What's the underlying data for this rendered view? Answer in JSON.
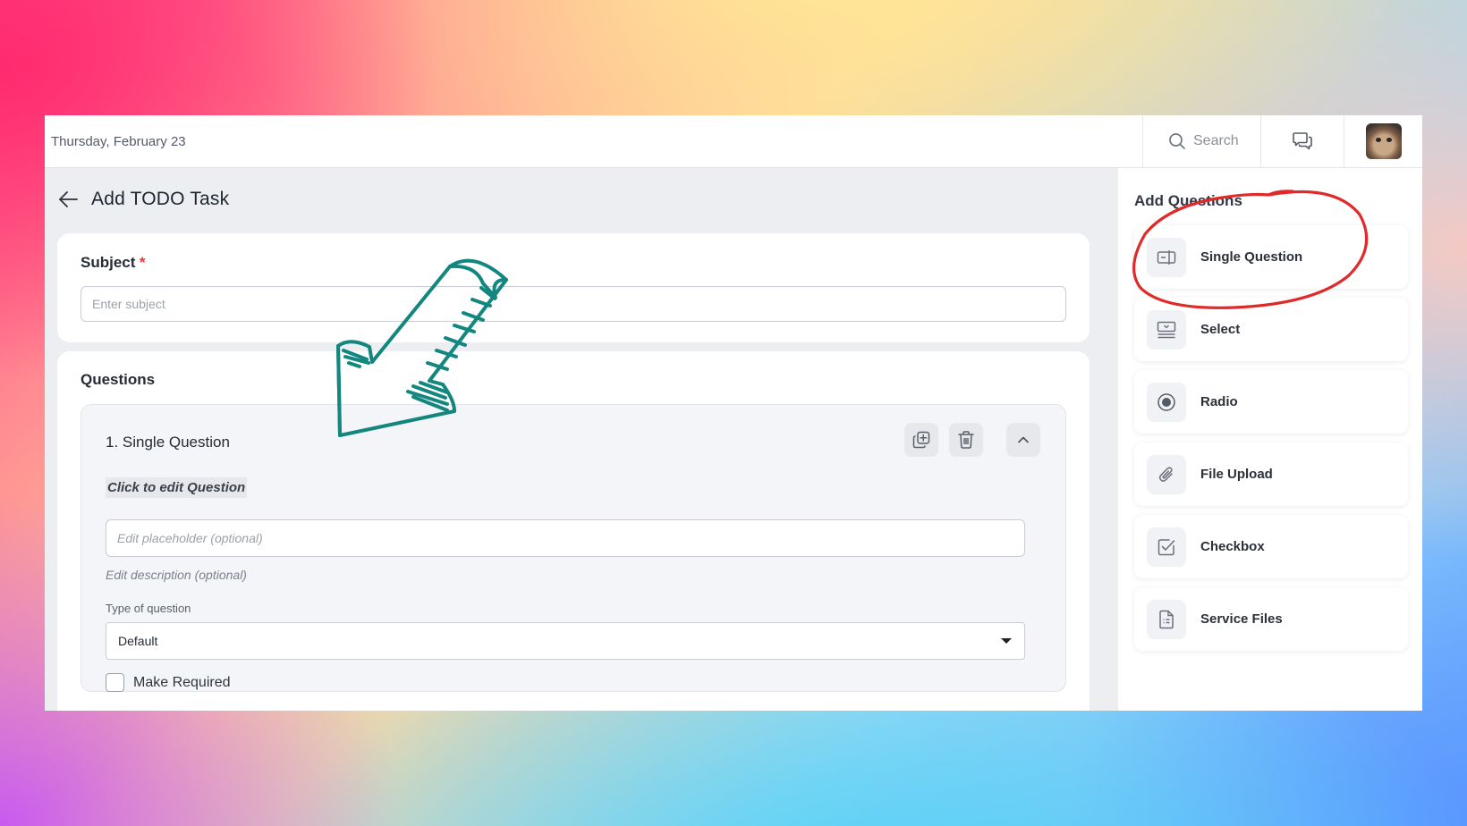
{
  "topbar": {
    "date": "Thursday, February 23",
    "search_label": "Search"
  },
  "page": {
    "title": "Add TODO Task"
  },
  "subject": {
    "label": "Subject",
    "required_mark": "*",
    "placeholder": "Enter subject"
  },
  "questions": {
    "label": "Questions",
    "items": [
      {
        "title": "1. Single Question",
        "edit_question": "Click to edit Question",
        "placeholder_hint": "Edit placeholder (optional)",
        "description_hint": "Edit description (optional)",
        "type_label": "Type of question",
        "type_value": "Default",
        "required_label": "Make Required",
        "required_checked": false
      }
    ]
  },
  "side_panel": {
    "title": "Add Questions",
    "items": [
      {
        "label": "Single Question",
        "icon": "input-field-icon"
      },
      {
        "label": "Select",
        "icon": "select-list-icon"
      },
      {
        "label": "Radio",
        "icon": "radio-icon"
      },
      {
        "label": "File Upload",
        "icon": "paperclip-icon"
      },
      {
        "label": "Checkbox",
        "icon": "checkbox-icon"
      },
      {
        "label": "Service Files",
        "icon": "document-icon"
      }
    ]
  },
  "annotations": {
    "arrow_color": "#12867f",
    "circle_color": "#e02a2a"
  }
}
